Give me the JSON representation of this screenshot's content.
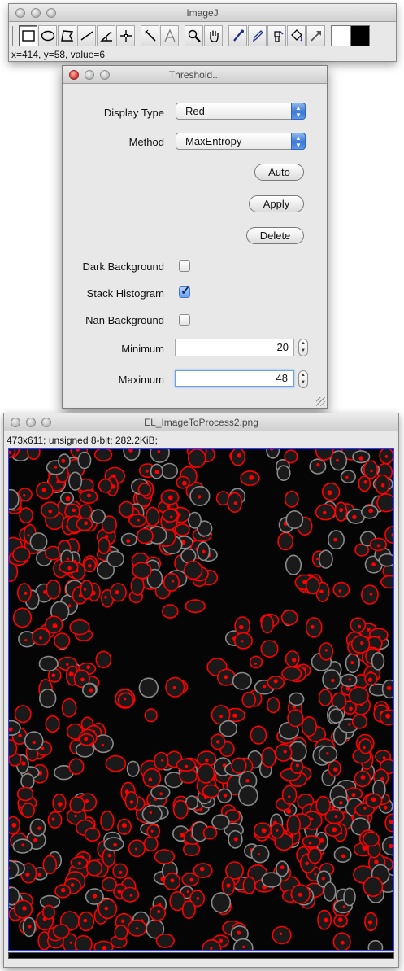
{
  "imagej": {
    "title": "ImageJ",
    "status": "x=414, y=58, value=6",
    "tools": [
      {
        "name": "rectangle-tool",
        "icon": "rectangle-icon"
      },
      {
        "name": "oval-tool",
        "icon": "oval-icon"
      },
      {
        "name": "polygon-tool",
        "icon": "polygon-icon"
      },
      {
        "name": "line-tool",
        "icon": "line-icon"
      },
      {
        "name": "angle-tool",
        "icon": "angle-icon"
      },
      {
        "name": "point-tool",
        "icon": "crosshair-icon"
      },
      {
        "name": "wand-tool",
        "icon": "wand-icon"
      },
      {
        "name": "text-tool",
        "icon": "text-icon"
      },
      {
        "name": "magnifier-tool",
        "icon": "magnifier-icon"
      },
      {
        "name": "scroll-tool",
        "icon": "hand-icon"
      },
      {
        "name": "color-picker-tool",
        "icon": "dropper-icon"
      },
      {
        "name": "pencil-tool",
        "icon": "pencil-icon"
      },
      {
        "name": "brush-tool",
        "icon": "brush-icon"
      },
      {
        "name": "flood-fill-tool",
        "icon": "bucket-icon"
      },
      {
        "name": "arrow-tool",
        "icon": "arrow-icon"
      }
    ],
    "foreground_color": "#ffffff",
    "background_color": "#000000"
  },
  "threshold": {
    "title": "Threshold...",
    "display_type_label": "Display Type",
    "display_type_value": "Red",
    "method_label": "Method",
    "method_value": "MaxEntropy",
    "auto_label": "Auto",
    "apply_label": "Apply",
    "delete_label": "Delete",
    "dark_background_label": "Dark Background",
    "dark_background_checked": false,
    "stack_histogram_label": "Stack Histogram",
    "stack_histogram_checked": true,
    "nan_background_label": "Nan Background",
    "nan_background_checked": false,
    "minimum_label": "Minimum",
    "minimum_value": "20",
    "maximum_label": "Maximum",
    "maximum_value": "48"
  },
  "image_window": {
    "title": "EL_ImageToProcess2.png",
    "info": "473x611; unsigned 8-bit; 282.2KiB;",
    "overlay_color": "#ff0000",
    "cell_color": "#8a8a8a"
  }
}
